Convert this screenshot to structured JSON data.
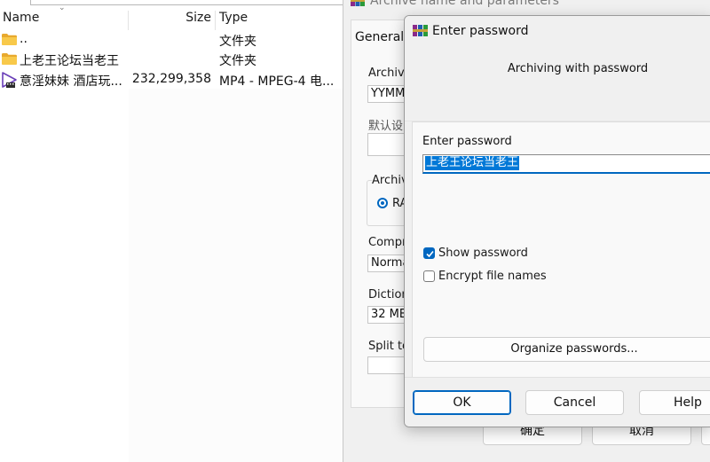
{
  "filelist": {
    "headers": {
      "name": "Name",
      "size": "Size",
      "type": "Type"
    },
    "rows": [
      {
        "name": "..",
        "size": "",
        "type": "文件夹",
        "icon": "folder-icon"
      },
      {
        "name": "上老王论坛当老王",
        "size": "",
        "type": "文件夹",
        "icon": "folder-icon"
      },
      {
        "name": "意淫妹妹  酒店玩...",
        "size": "232,299,358",
        "type": "MP4 - MPEG-4 电...",
        "icon": "video-file-icon"
      }
    ]
  },
  "archive_dialog": {
    "title": "Archive name and parameters",
    "tab_general": "General",
    "archive_name_label": "Archive",
    "archive_name_value": "YYMM.",
    "default_label": "默认设",
    "archive_format_label": "Archiv",
    "format_option": "RA",
    "compression_label": "Compre",
    "compression_value": "Norma",
    "dictionary_label": "Dictiona",
    "dictionary_value": "32 MB",
    "split_label": "Split to",
    "ok_label": "确定",
    "cancel_label": "取消"
  },
  "password_dialog": {
    "title": "Enter password",
    "subtitle": "Archiving with password",
    "password_label": "Enter password",
    "password_value": "上老王论坛当老王",
    "show_password_label": "Show password",
    "show_password_checked": true,
    "encrypt_names_label": "Encrypt file names",
    "encrypt_names_checked": false,
    "organize_label": "Organize passwords...",
    "ok_label": "OK",
    "cancel_label": "Cancel",
    "help_label": "Help",
    "accent_color": "#0067c0",
    "selection_color": "#0078d7"
  }
}
